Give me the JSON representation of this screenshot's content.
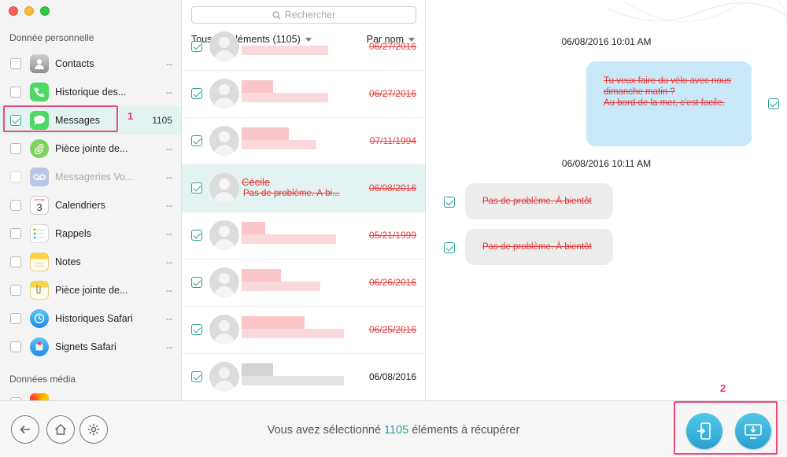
{
  "sidebar": {
    "section_personal": "Donnée personnelle",
    "section_media": "Données média",
    "items": [
      {
        "label": "Contacts",
        "count": "--"
      },
      {
        "label": "Historique des...",
        "count": "--"
      },
      {
        "label": "Messages",
        "count": "1105"
      },
      {
        "label": "Pièce jointe de...",
        "count": "--"
      },
      {
        "label": "Messageries Vo...",
        "count": "--"
      },
      {
        "label": "Calendriers",
        "count": "--"
      },
      {
        "label": "Rappels",
        "count": "--"
      },
      {
        "label": "Notes",
        "count": "--"
      },
      {
        "label": "Pièce jointe de...",
        "count": "--"
      },
      {
        "label": "Historiques Safari",
        "count": "--"
      },
      {
        "label": "Signets Safari",
        "count": "--"
      }
    ],
    "calendar_month": "Sunday",
    "calendar_day": "3",
    "annotation_1": "1"
  },
  "list": {
    "search_placeholder": "Rechercher",
    "all_items": "Tous les éléments (1105)",
    "sort": "Par nom",
    "rows": [
      {
        "date": "06/27/2016"
      },
      {
        "date": "06/27/2016"
      },
      {
        "date": "07/11/1994"
      },
      {
        "name": "Cécile",
        "preview": "Pas de problème. À bi...",
        "date": "06/08/2016"
      },
      {
        "date": "05/21/1999"
      },
      {
        "date": "06/26/2016"
      },
      {
        "date": "06/25/2016"
      },
      {
        "date": "06/08/2016"
      }
    ]
  },
  "conversation": {
    "timestamp_1": "06/08/2016 10:01 AM",
    "bubble_out_lines": [
      "Tu veux faire du vélo avec nous",
      "dimanche matin ?",
      "Au bord de la mer, c'est facile."
    ],
    "timestamp_2": "06/08/2016 10:11 AM",
    "bubble_in_1": "Pas de problème. À bientôt",
    "bubble_in_2": "Pas de problème. À bientôt"
  },
  "bottom": {
    "status_prefix": "Vous avez sélectionné",
    "status_count": "1105",
    "status_suffix": "éléments à récupérer",
    "annotation_2": "2"
  },
  "colors": {
    "accent": "#2aa198",
    "highlight": "#f0487a",
    "deleted_text": "#e23a3a"
  }
}
